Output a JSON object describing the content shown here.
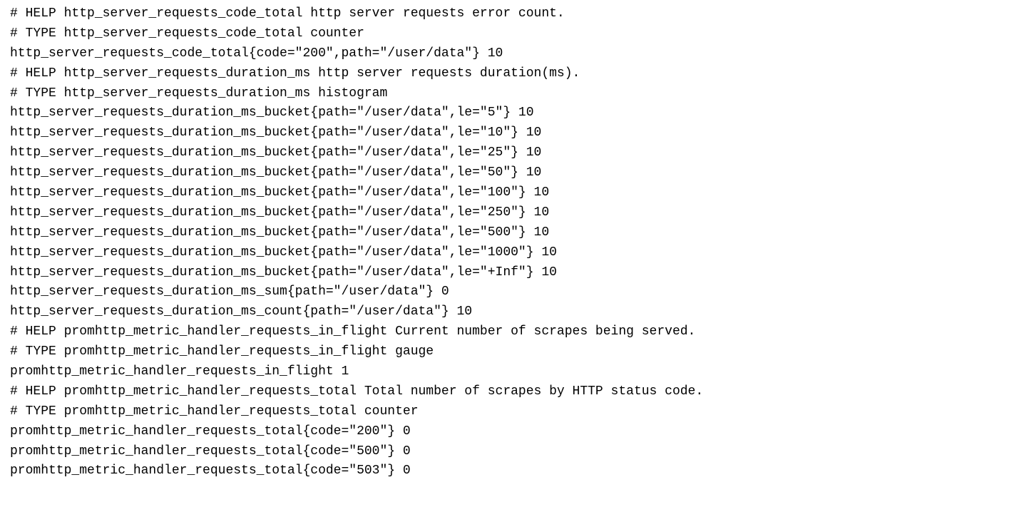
{
  "lines": [
    "# HELP http_server_requests_code_total http server requests error count.",
    "# TYPE http_server_requests_code_total counter",
    "http_server_requests_code_total{code=\"200\",path=\"/user/data\"} 10",
    "# HELP http_server_requests_duration_ms http server requests duration(ms).",
    "# TYPE http_server_requests_duration_ms histogram",
    "http_server_requests_duration_ms_bucket{path=\"/user/data\",le=\"5\"} 10",
    "http_server_requests_duration_ms_bucket{path=\"/user/data\",le=\"10\"} 10",
    "http_server_requests_duration_ms_bucket{path=\"/user/data\",le=\"25\"} 10",
    "http_server_requests_duration_ms_bucket{path=\"/user/data\",le=\"50\"} 10",
    "http_server_requests_duration_ms_bucket{path=\"/user/data\",le=\"100\"} 10",
    "http_server_requests_duration_ms_bucket{path=\"/user/data\",le=\"250\"} 10",
    "http_server_requests_duration_ms_bucket{path=\"/user/data\",le=\"500\"} 10",
    "http_server_requests_duration_ms_bucket{path=\"/user/data\",le=\"1000\"} 10",
    "http_server_requests_duration_ms_bucket{path=\"/user/data\",le=\"+Inf\"} 10",
    "http_server_requests_duration_ms_sum{path=\"/user/data\"} 0",
    "http_server_requests_duration_ms_count{path=\"/user/data\"} 10",
    "# HELP promhttp_metric_handler_requests_in_flight Current number of scrapes being served.",
    "# TYPE promhttp_metric_handler_requests_in_flight gauge",
    "promhttp_metric_handler_requests_in_flight 1",
    "# HELP promhttp_metric_handler_requests_total Total number of scrapes by HTTP status code.",
    "# TYPE promhttp_metric_handler_requests_total counter",
    "promhttp_metric_handler_requests_total{code=\"200\"} 0",
    "promhttp_metric_handler_requests_total{code=\"500\"} 0",
    "promhttp_metric_handler_requests_total{code=\"503\"} 0"
  ]
}
